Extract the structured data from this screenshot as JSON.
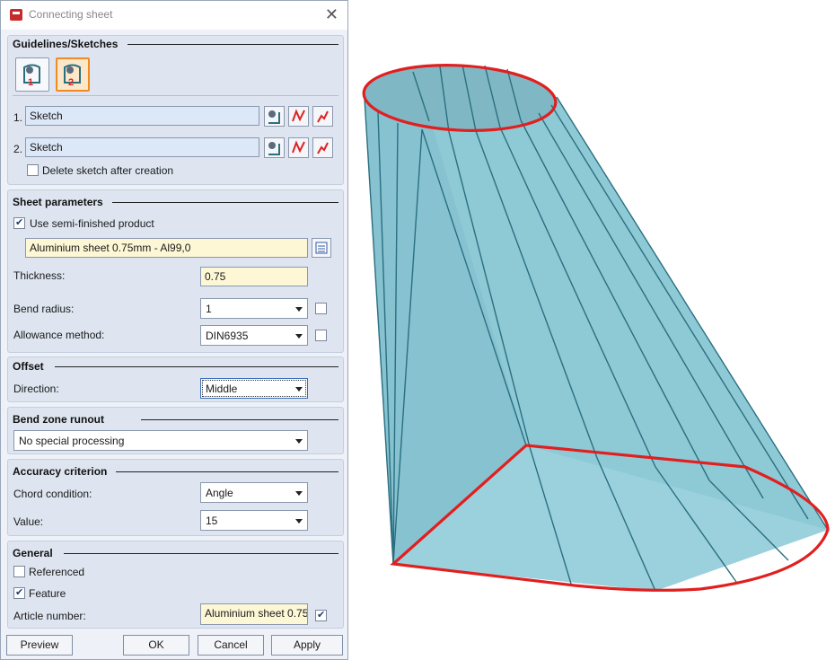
{
  "window": {
    "title": "Connecting sheet"
  },
  "guidelines": {
    "title": "Guidelines/Sketches",
    "rows": [
      {
        "index": "1.",
        "value": "Sketch"
      },
      {
        "index": "2.",
        "value": "Sketch"
      }
    ],
    "delete_label": "Delete sketch after creation"
  },
  "sheet": {
    "title": "Sheet parameters",
    "semi_finished_label": "Use semi-finished product",
    "product": "Aluminium sheet 0.75mm - Al99,0",
    "thickness_label": "Thickness:",
    "thickness": "0.75",
    "bend_radius_label": "Bend radius:",
    "bend_radius": "1",
    "allowance_label": "Allowance method:",
    "allowance": "DIN6935"
  },
  "offset": {
    "title": "Offset",
    "direction_label": "Direction:",
    "direction": "Middle"
  },
  "bend_zone": {
    "title": "Bend zone runout",
    "value": "No special processing"
  },
  "accuracy": {
    "title": "Accuracy criterion",
    "chord_label": "Chord condition:",
    "chord": "Angle",
    "value_label": "Value:",
    "value": "15"
  },
  "general": {
    "title": "General",
    "referenced_label": "Referenced",
    "feature_label": "Feature",
    "article_label": "Article number:",
    "article": "Aluminium sheet 0.75"
  },
  "buttons": {
    "preview": "Preview",
    "ok": "OK",
    "cancel": "Cancel",
    "apply": "Apply"
  },
  "colors": {
    "fill": "#8ec9d6",
    "edge": "#2a6f80",
    "outline": "#e11f1f",
    "accent": "#f08a24"
  }
}
